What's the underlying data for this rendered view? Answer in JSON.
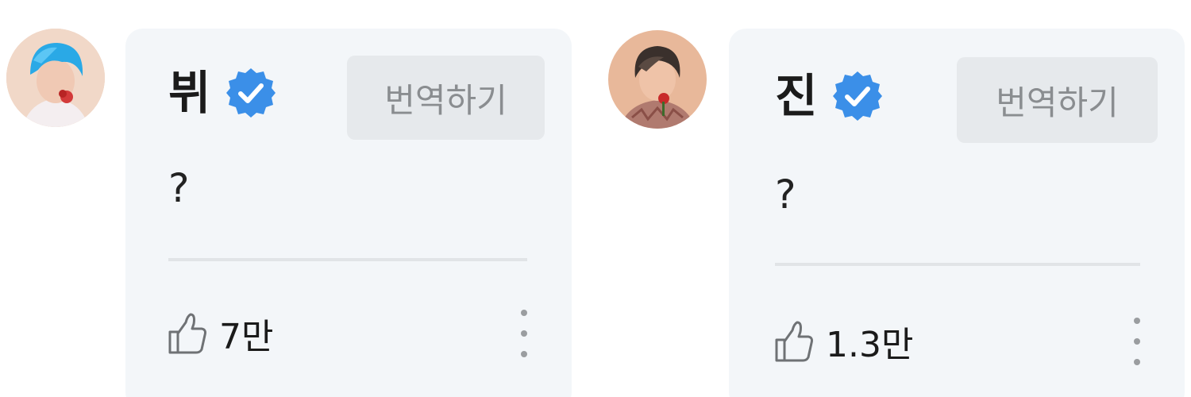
{
  "comments": [
    {
      "author": "뷔",
      "verified": true,
      "translate_label": "번역하기",
      "text": "?",
      "likes": "7만",
      "avatar_icon": "profile-photo-blue-hair",
      "more_icon": "kebab-menu-icon"
    },
    {
      "author": "진",
      "verified": true,
      "translate_label": "번역하기",
      "text": "?",
      "likes": "1.3만",
      "avatar_icon": "profile-photo-dark-hair",
      "more_icon": "kebab-menu-icon"
    }
  ],
  "colors": {
    "verified_badge": "#3b8fe8",
    "bubble_bg": "#f3f6f9",
    "translate_bg": "#e6e9ec"
  }
}
